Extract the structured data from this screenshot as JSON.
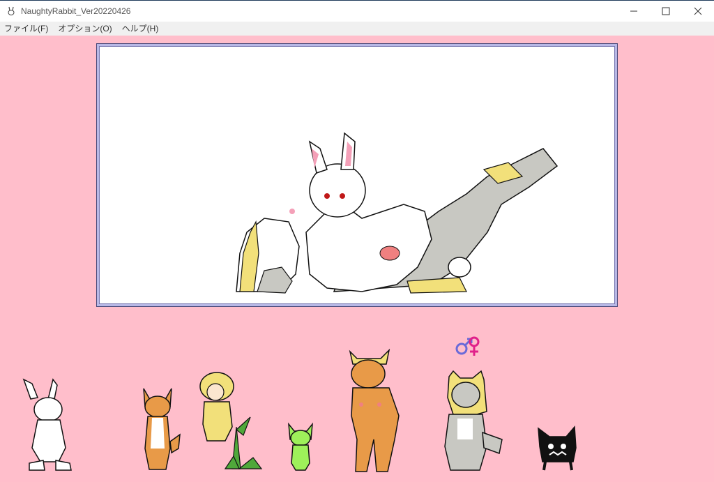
{
  "window": {
    "title": "NaughtyRabbit_Ver20220426",
    "icons": {
      "app": "rabbit-app-icon",
      "minimize": "minimize-icon",
      "maximize": "maximize-icon",
      "close": "close-icon"
    }
  },
  "menu": {
    "items": [
      {
        "label": "ファイル(F)"
      },
      {
        "label": "オプション(O)"
      },
      {
        "label": "ヘルプ(H)"
      }
    ]
  },
  "scene": {
    "description_icon": "scene-sprite"
  },
  "characters": [
    {
      "id": "white-rabbit",
      "icon": "white-rabbit-sprite"
    },
    {
      "id": "orange-cat",
      "icon": "orange-cat-sprite"
    },
    {
      "id": "sheep-plant",
      "icon": "sheep-plant-sprite"
    },
    {
      "id": "green-cat",
      "icon": "green-cat-sprite"
    },
    {
      "id": "cow",
      "icon": "cow-sprite"
    },
    {
      "id": "grey-wolf",
      "icon": "grey-wolf-sprite"
    },
    {
      "id": "black-shadow",
      "icon": "black-shadow-sprite"
    }
  ],
  "colors": {
    "background": "#ffbecb",
    "frame_border": "#b8b8e6",
    "menu_bg": "#f0f0f0",
    "gender_male": "#6a6ad8",
    "gender_female": "#e0208a"
  }
}
